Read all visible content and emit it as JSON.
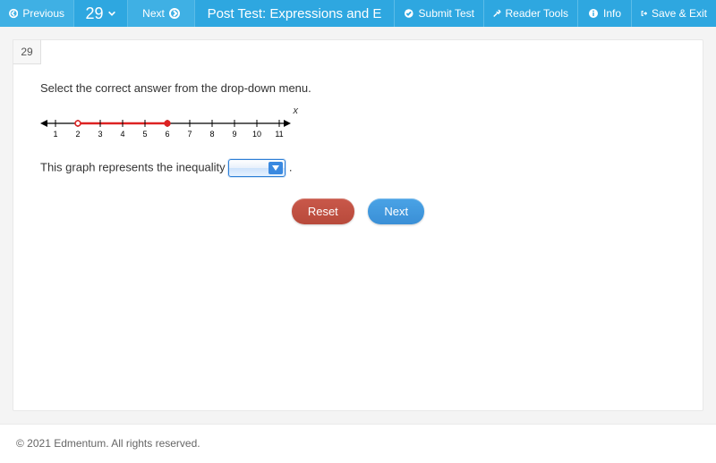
{
  "topbar": {
    "previous": "Previous",
    "question_number": "29",
    "next": "Next",
    "title": "Post Test: Expressions and E",
    "submit": "Submit Test",
    "reader_tools": "Reader Tools",
    "info": "Info",
    "save_exit": "Save & Exit"
  },
  "question": {
    "badge": "29",
    "prompt": "Select the correct answer from the drop-down menu.",
    "sentence_prefix": "This graph represents the inequality ",
    "sentence_suffix": ".",
    "axis_variable": "x",
    "numberline": {
      "ticks": [
        "1",
        "2",
        "3",
        "4",
        "5",
        "6",
        "7",
        "8",
        "9",
        "10",
        "11"
      ],
      "open_point": 2,
      "closed_point": 6,
      "segment_from": 2,
      "segment_to": 6
    },
    "dropdown_value": ""
  },
  "buttons": {
    "reset": "Reset",
    "next": "Next"
  },
  "footer": "© 2021 Edmentum. All rights reserved."
}
